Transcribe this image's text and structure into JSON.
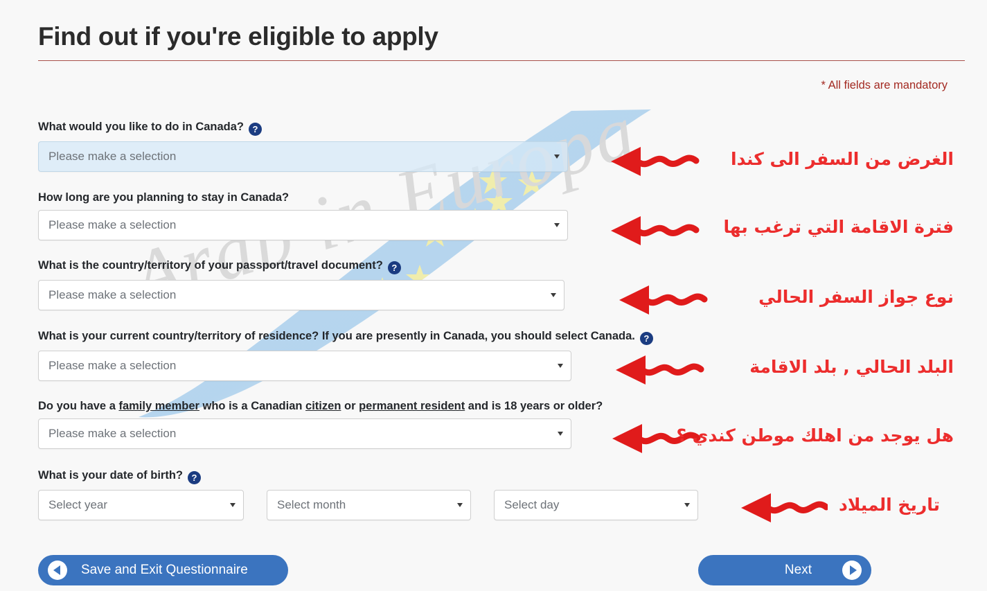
{
  "page": {
    "title": "Find out if you're eligible to apply",
    "mandatory_note": "* All fields are mandatory",
    "watermark_text": "Arab in Europa"
  },
  "form": {
    "fields": [
      {
        "id": "purpose",
        "label": "What would you like to do in Canada?",
        "has_help": true,
        "placeholder": "Please make a selection",
        "focused": true
      },
      {
        "id": "duration",
        "label": "How long are you planning to stay in Canada?",
        "has_help": false,
        "placeholder": "Please make a selection",
        "focused": false
      },
      {
        "id": "passport-country",
        "label": "What is the country/territory of your passport/travel document?",
        "has_help": true,
        "placeholder": "Please make a selection",
        "focused": false
      },
      {
        "id": "residence-country",
        "label": "What is your current country/territory of residence? If you are presently in Canada, you should select Canada.",
        "has_help": true,
        "placeholder": "Please make a selection",
        "focused": false
      },
      {
        "id": "family-member",
        "label_parts": [
          {
            "text": "Do you have a ",
            "link": false
          },
          {
            "text": "family member",
            "link": true
          },
          {
            "text": " who is a Canadian ",
            "link": false
          },
          {
            "text": "citizen",
            "link": true
          },
          {
            "text": " or ",
            "link": false
          },
          {
            "text": "permanent resident",
            "link": true
          },
          {
            "text": " and is 18 years or older?",
            "link": false
          }
        ],
        "has_help": false,
        "placeholder": "Please make a selection",
        "focused": false
      }
    ],
    "dob": {
      "label": "What is your date of birth?",
      "has_help": true,
      "year_placeholder": "Select year",
      "month_placeholder": "Select month",
      "day_placeholder": "Select day"
    },
    "help_icon_glyph": "?",
    "help_icon_name": "question-mark-icon"
  },
  "annotations": [
    {
      "id": "note-purpose",
      "text": "الغرض من السفر الى كندا"
    },
    {
      "id": "note-duration",
      "text": "فترة الاقامة التي ترغب بها"
    },
    {
      "id": "note-passport",
      "text": "نوع جواز السفر الحالي"
    },
    {
      "id": "note-residence",
      "text": "البلد الحالي , بلد الاقامة"
    },
    {
      "id": "note-family",
      "text": "هل يوجد من اهلك موطن كندي ؟"
    },
    {
      "id": "note-dob",
      "text": "تاريخ الميلاد"
    }
  ],
  "buttons": {
    "save_exit_label": "Save and Exit Questionnaire",
    "next_label": "Next"
  },
  "colors": {
    "accent_blue": "#3b74bf",
    "help_badge": "#1b3c81",
    "annotation_red": "#ec2d2d",
    "mandatory_red": "#a32a22",
    "rule_red": "#a8504a",
    "page_bg": "#f8f8f8"
  }
}
